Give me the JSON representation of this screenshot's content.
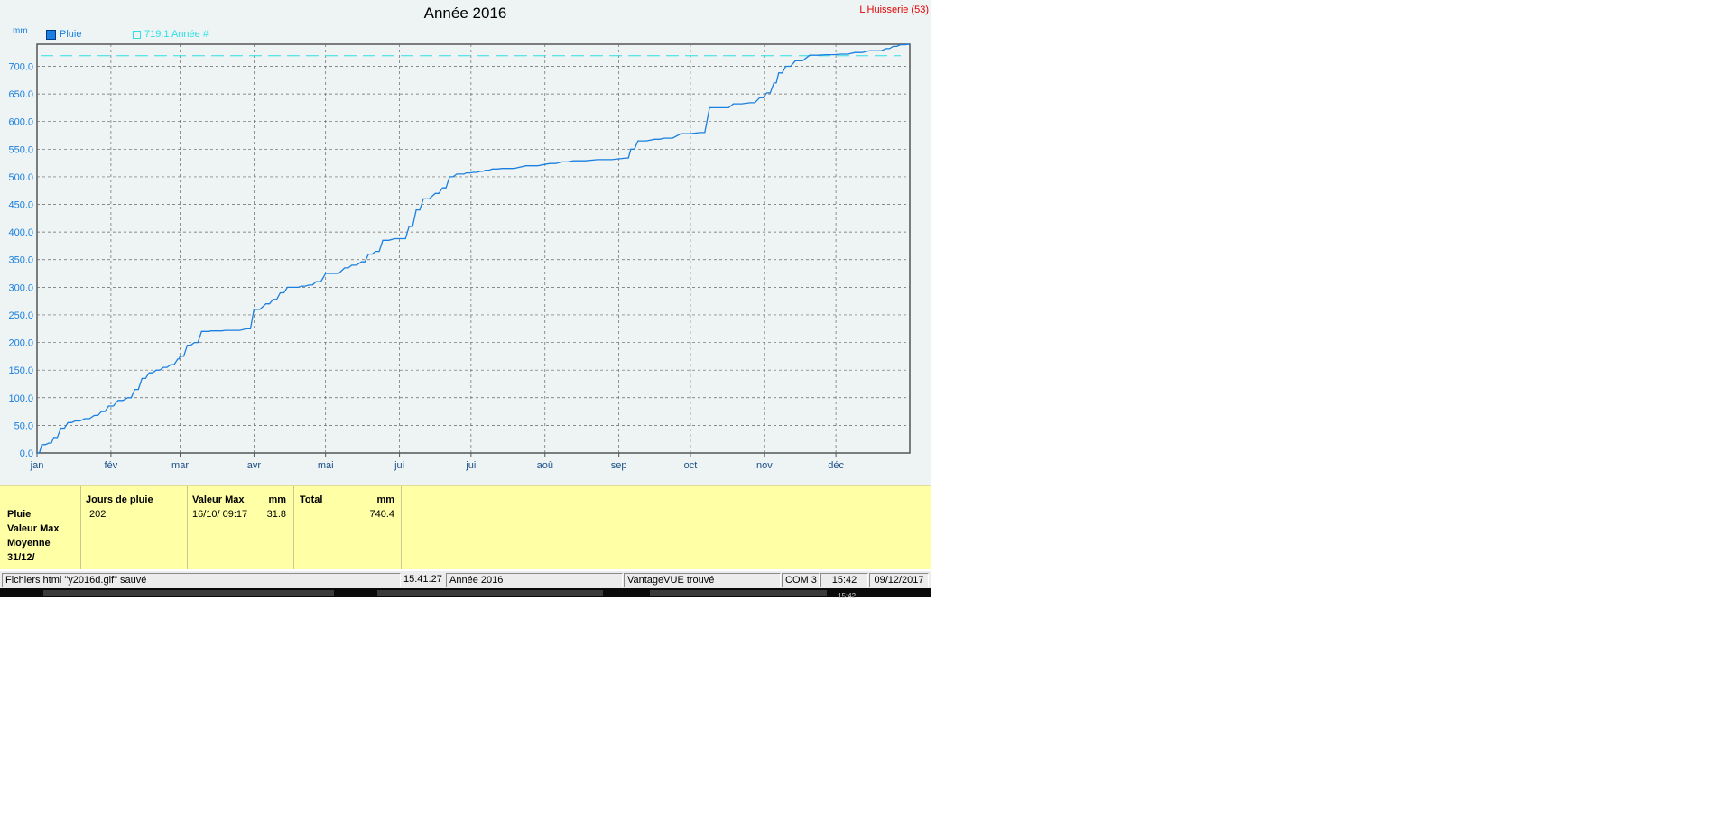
{
  "chart": {
    "title": "Année 2016",
    "station": "L'Huisserie (53)",
    "unit": "mm",
    "legend_series": "Pluie",
    "legend_ref": "719.1 Année #",
    "colors": {
      "series": "#1a7fe0",
      "reference": "#2ee0e6",
      "axis_text": "#1a7fe0",
      "grid": "#666666"
    }
  },
  "chart_data": {
    "type": "line",
    "title": "Année 2016",
    "ylabel": "mm",
    "ylim": [
      0,
      740
    ],
    "yticks": [
      "0.0",
      "50.0",
      "100.0",
      "150.0",
      "200.0",
      "250.0",
      "300.0",
      "350.0",
      "400.0",
      "450.0",
      "500.0",
      "550.0",
      "600.0",
      "650.0",
      "700.0"
    ],
    "xlim": [
      0,
      366
    ],
    "xtick_days": [
      0,
      31,
      60,
      91,
      121,
      152,
      182,
      213,
      244,
      274,
      305,
      335
    ],
    "xtick_labels": [
      "jan",
      "fév",
      "mar",
      "avr",
      "mai",
      "jui",
      "jui",
      "aoû",
      "sep",
      "oct",
      "nov",
      "déc"
    ],
    "grid": true,
    "reference_line": {
      "label": "719.1 Année #",
      "value": 719.1
    },
    "series": [
      {
        "name": "Pluie",
        "x": [
          0,
          2,
          5,
          7,
          10,
          13,
          16,
          20,
          24,
          27,
          30,
          34,
          38,
          41,
          44,
          47,
          50,
          53,
          56,
          59,
          60,
          63,
          66,
          69,
          71,
          73,
          76,
          79,
          82,
          88,
          91,
          96,
          99,
          102,
          105,
          108,
          111,
          114,
          117,
          121,
          124,
          129,
          132,
          136,
          139,
          142,
          145,
          150,
          153,
          156,
          159,
          162,
          167,
          170,
          173,
          176,
          178,
          180,
          183,
          186,
          188,
          191,
          195,
          205,
          215,
          220,
          225,
          235,
          247,
          249,
          252,
          259,
          263,
          270,
          278,
          282,
          288,
          292,
          299,
          303,
          306,
          309,
          311,
          314,
          318,
          324,
          331,
          337,
          343,
          349,
          352,
          356,
          359,
          362,
          366
        ],
        "y": [
          0,
          15,
          18,
          28,
          45,
          55,
          58,
          62,
          68,
          75,
          85,
          95,
          100,
          115,
          135,
          145,
          150,
          155,
          160,
          170,
          175,
          195,
          200,
          220,
          220,
          221,
          221,
          222,
          222,
          225,
          260,
          270,
          278,
          290,
          300,
          300,
          302,
          304,
          310,
          325,
          325,
          335,
          340,
          346,
          360,
          365,
          385,
          388,
          388,
          410,
          440,
          460,
          470,
          480,
          500,
          505,
          505,
          507,
          508,
          510,
          512,
          514,
          515,
          520,
          524,
          527,
          529,
          531,
          534,
          550,
          565,
          568,
          570,
          578,
          580,
          625,
          625,
          632,
          634,
          643,
          652,
          670,
          688,
          700,
          710,
          720,
          721,
          722,
          725,
          728,
          728,
          732,
          736,
          739,
          740.4
        ]
      }
    ]
  },
  "summary": {
    "row_labels": [
      "Pluie",
      "Valeur Max",
      "Moyenne",
      "31/12/"
    ],
    "jours": {
      "header": "Jours de pluie",
      "value": "202"
    },
    "max": {
      "header": "Valeur Max",
      "unit": "mm",
      "date": "16/10/  09:17",
      "value": "31.8"
    },
    "total": {
      "header": "Total",
      "unit": "mm",
      "value": "740.4"
    }
  },
  "status_bar": {
    "message": "Fichiers html  \"y2016d.gif\"  sauvé",
    "time": "15:41:27",
    "period": "Année 2016",
    "station_status": "VantageVUE trouvé",
    "port": "COM 3",
    "clock": "15:42",
    "date": "09/12/2017"
  },
  "taskbar": {
    "clock": "15:42"
  }
}
